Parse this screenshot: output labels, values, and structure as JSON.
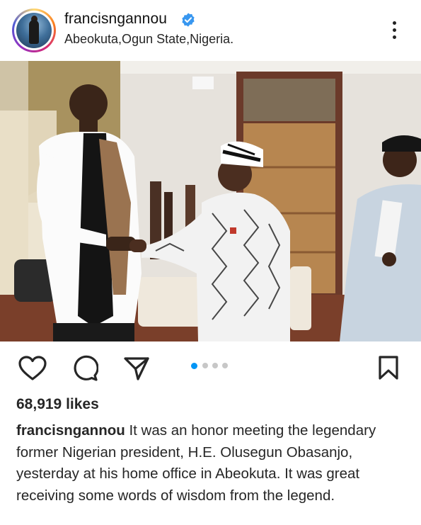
{
  "post": {
    "username": "francisngannou",
    "location": "Abeokuta,Ogun State,Nigeria.",
    "likes": "68,919 likes",
    "caption_text": "It was an honor meeting the legendary former Nigerian president, H.E. Olusegun Obasanjo, yesterday at his home office in Abeokuta. It was great receiving some words of wisdom from the legend.",
    "carousel": {
      "current": 1,
      "total": 4
    }
  },
  "icons": [
    "verified-badge-icon",
    "more-options-icon",
    "heart-icon",
    "comment-icon",
    "share-icon",
    "bookmark-icon"
  ],
  "colors": {
    "accent": "#0095f6",
    "text": "#262626",
    "verified": "#3897f0"
  }
}
